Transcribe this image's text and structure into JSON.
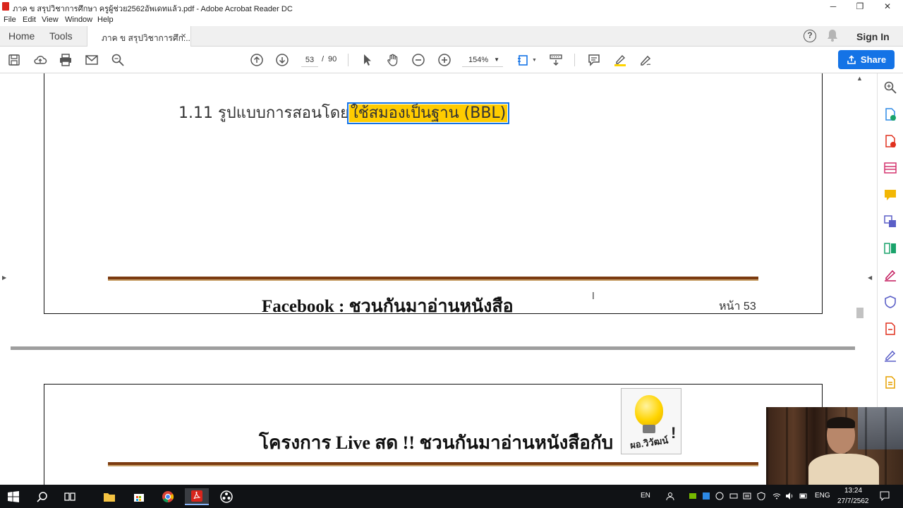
{
  "window": {
    "title": "ภาค ข สรุปวิชาการศึกษา ครูผู้ช่วย2562อัพเดทแล้ว.pdf - Adobe Acrobat Reader DC",
    "minimize": "─",
    "maximize": "❐",
    "close": "✕"
  },
  "menu": [
    "File",
    "Edit",
    "View",
    "Window",
    "Help"
  ],
  "tabs": {
    "home": "Home",
    "tools": "Tools",
    "document": "ภาค ข สรุปวิชาการศึก...",
    "close": "×",
    "sign_in": "Sign In",
    "help": "?"
  },
  "toolbar": {
    "current_page": "53",
    "page_sep": "/",
    "total_pages": "90",
    "zoom": "154%",
    "zoom_caret": "▼",
    "share": "Share"
  },
  "document": {
    "heading_prefix": "1.11 รูปแบบการสอนโดย",
    "heading_highlight": "ใช้สมองเป็นฐาน (BBL)",
    "footer_facebook": "Facebook : ชวนกันมาอ่านหนังสือ",
    "page_label": "หน้า 53",
    "next_page_title": "โครงการ Live สด !! ชวนกันมาอ่านหนังสือกับ",
    "logo_text": "ผอ.วิวัฒน์",
    "logo_excl": "!",
    "cursor": "Ⅰ",
    "left_collapse": "▶",
    "right_collapse": "◀",
    "scroll_up": "▲"
  },
  "taskbar": {
    "lang_short": "EN",
    "lang": "ENG",
    "time": "13:24",
    "date": "27/7/2562"
  },
  "colors": {
    "accent": "#1473e6",
    "highlight": "#ffcc00",
    "rule": "#7b3a10",
    "acrobat_red": "#d9251c"
  }
}
